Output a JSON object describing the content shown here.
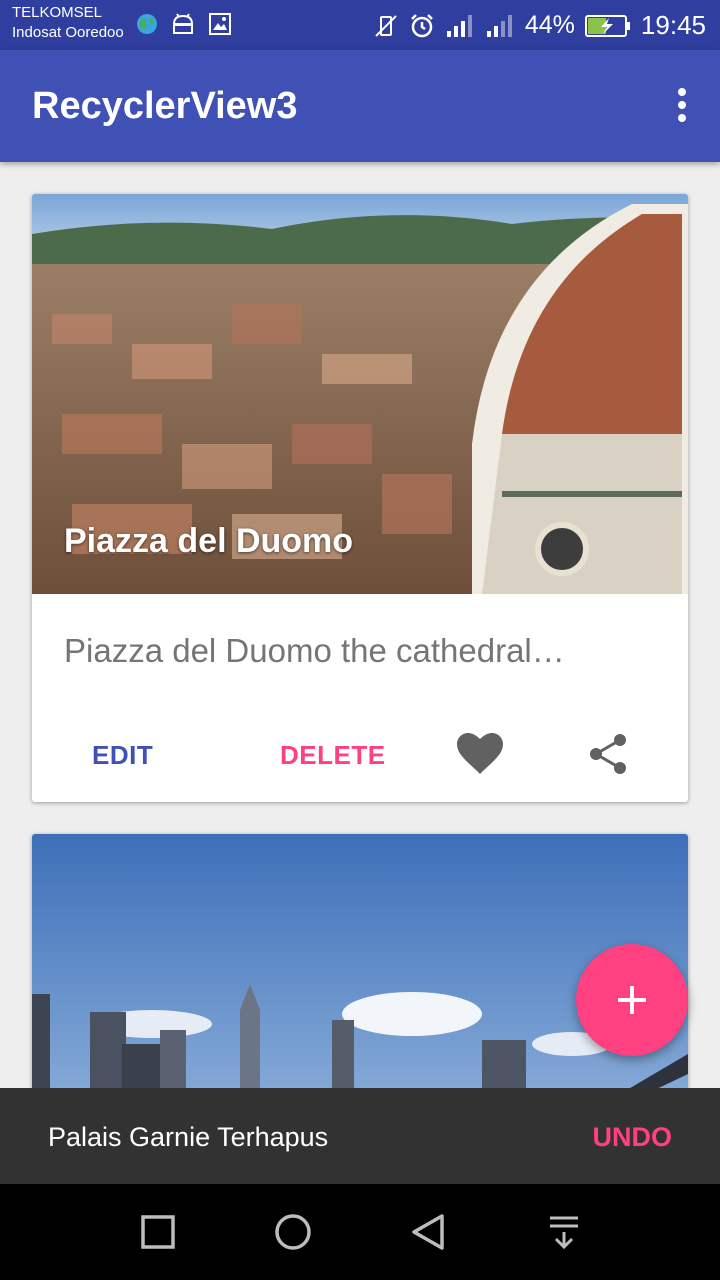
{
  "status_bar": {
    "carrier_primary": "TELKOMSEL",
    "carrier_secondary": "Indosat Ooredoo",
    "battery_percent": "44%",
    "time": "19:45"
  },
  "app_bar": {
    "title": "RecyclerView3"
  },
  "cards": [
    {
      "title": "Piazza del Duomo",
      "description": "Piazza del Duomo the cathedral…",
      "edit_label": "EDIT",
      "delete_label": "DELETE"
    }
  ],
  "snackbar": {
    "message": "Palais Garnie Terhapus",
    "action_label": "UNDO"
  },
  "colors": {
    "primary": "#3f51b5",
    "primary_dark": "#303f9f",
    "accent": "#ff4081"
  }
}
